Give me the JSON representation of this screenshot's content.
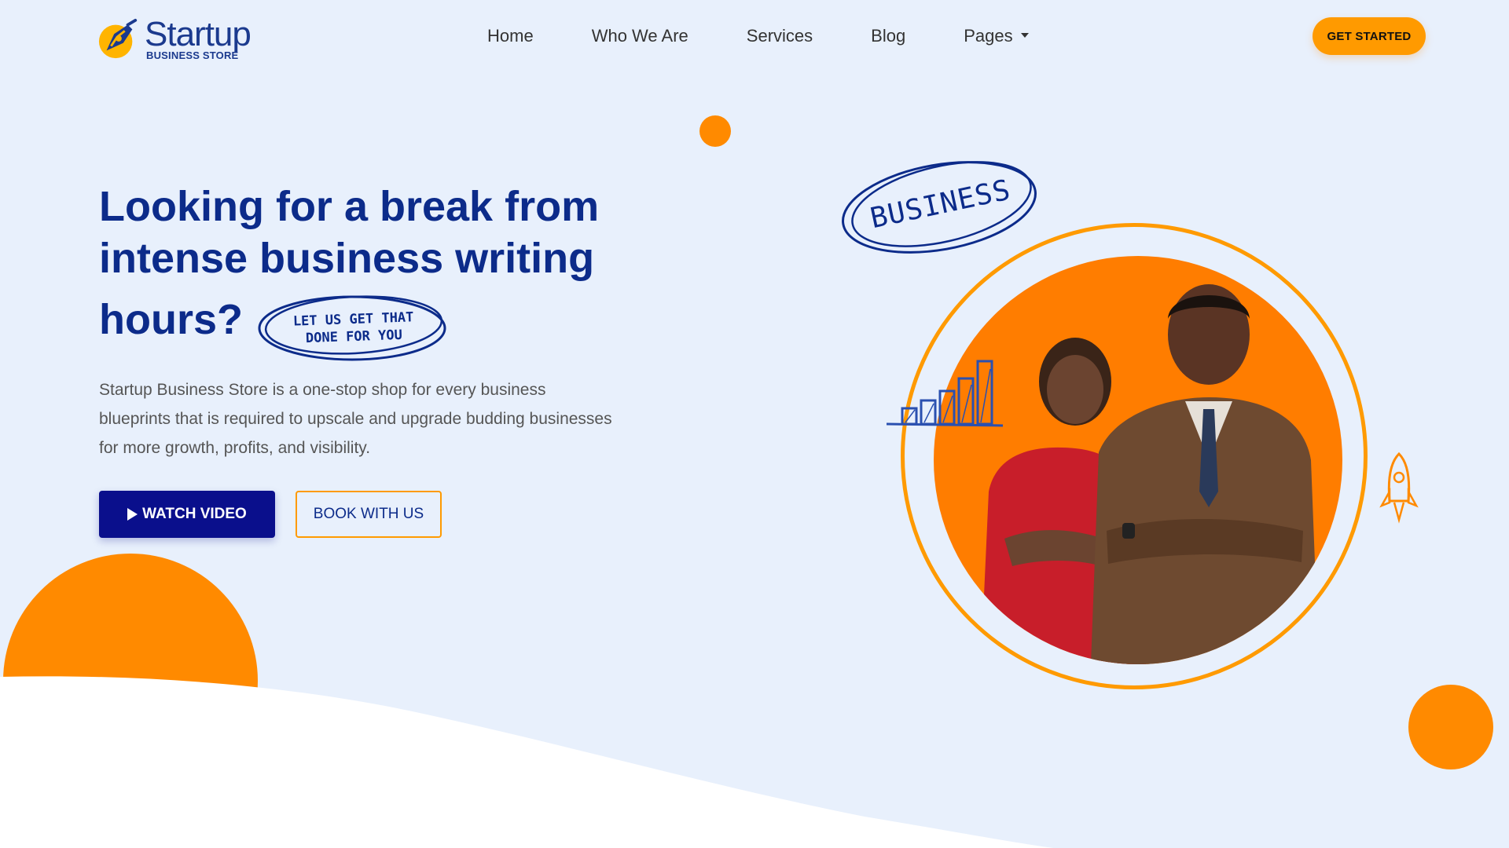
{
  "brand": {
    "name": "Startup",
    "tagline": "BUSINESS STORE"
  },
  "nav": {
    "items": [
      {
        "label": "Home"
      },
      {
        "label": "Who We Are"
      },
      {
        "label": "Services"
      },
      {
        "label": "Blog"
      },
      {
        "label": "Pages",
        "has_dropdown": true
      }
    ],
    "cta_label": "GET STARTED"
  },
  "hero": {
    "headline_line1": "Looking for a break from",
    "headline_line2": "intense business writing",
    "headline_line3": "hours?",
    "note_line1": "Let us get that",
    "note_line2": "done for you",
    "description": "Startup Business Store is a one-stop shop for every business blueprints that is required to upscale and upgrade budding businesses for more growth, profits, and visibility.",
    "watch_video_label": "WATCH VIDEO",
    "book_label": "BOOK WITH US",
    "badge_text": "BUSINESS"
  },
  "colors": {
    "background": "#e8f0fc",
    "primary": "#0c2b8a",
    "accent": "#ff8a00",
    "button_dark": "#0a0f8c"
  },
  "icons": {
    "play": "play-icon",
    "caret": "chevron-down-icon",
    "logo": "pen-nib-logo-icon",
    "rocket": "rocket-icon",
    "bars": "bar-chart-icon"
  }
}
